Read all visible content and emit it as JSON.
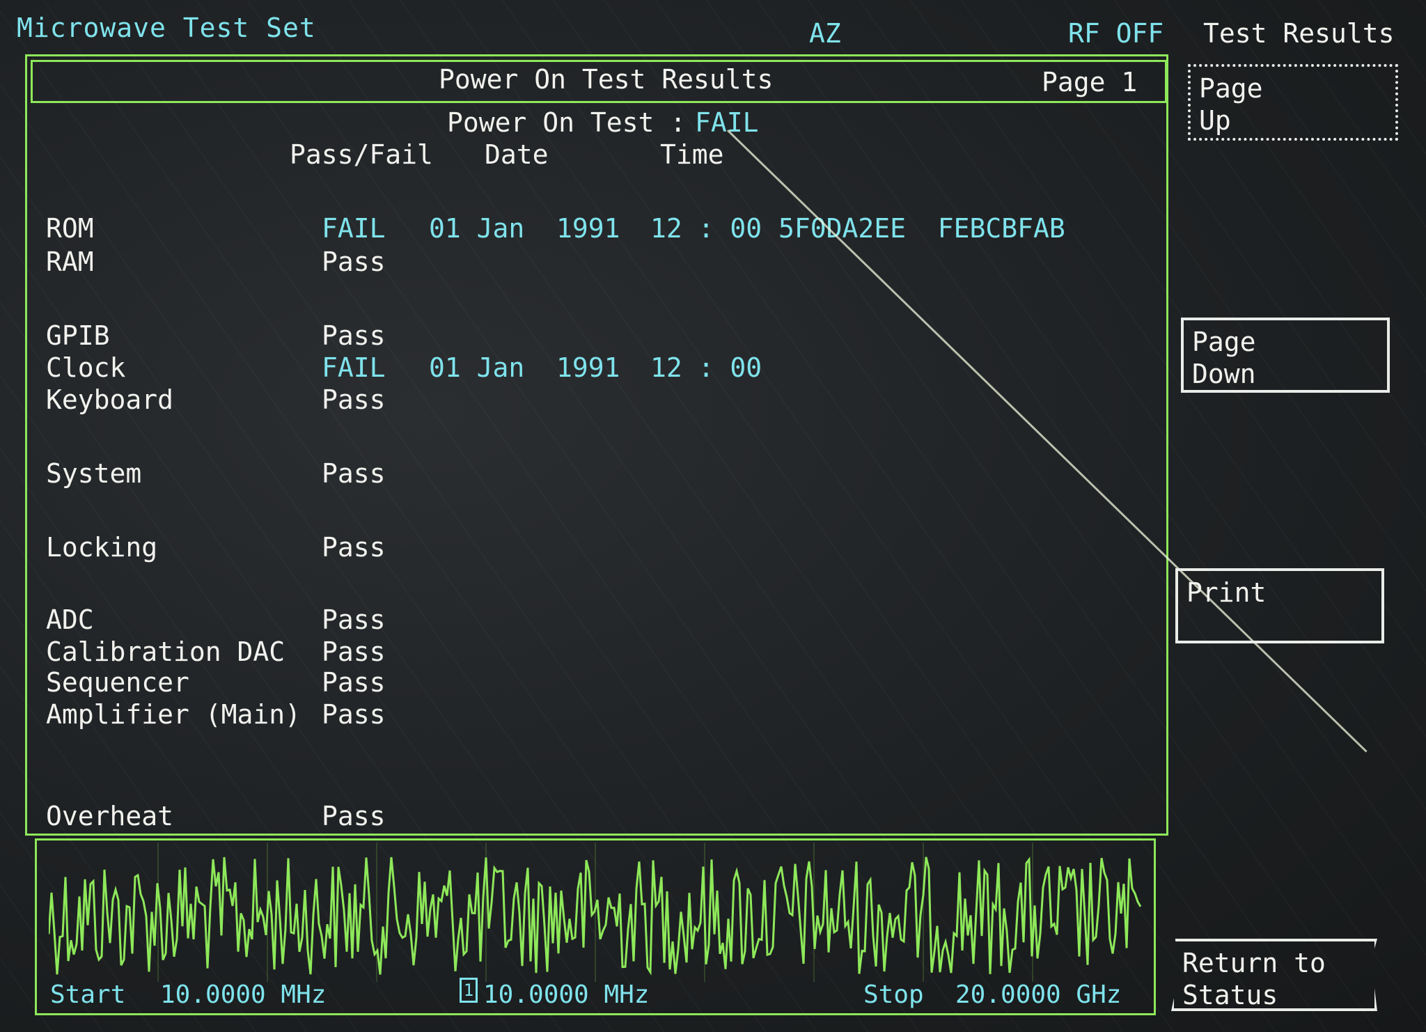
{
  "status_bar": {
    "instrument": "Microwave Test Set",
    "az": "AZ",
    "rf": "RF OFF",
    "menu_title": "Test Results"
  },
  "header": {
    "title": "Power On Test Results",
    "page": "Page 1"
  },
  "summary": {
    "label": "Power On Test :",
    "value": "FAIL"
  },
  "columns": {
    "pass_fail": "Pass/Fail",
    "date": "Date",
    "time": "Time"
  },
  "rows": [
    {
      "name": "ROM",
      "status": "FAIL",
      "date": "01 Jan  1991",
      "time": "12 : 00",
      "code": "5F0DA2EE  FEBCBFAB"
    },
    {
      "name": "RAM",
      "status": "Pass"
    },
    {
      "name": "GPIB",
      "status": "Pass"
    },
    {
      "name": "Clock",
      "status": "FAIL",
      "date": "01 Jan  1991",
      "time": "12 : 00"
    },
    {
      "name": "Keyboard",
      "status": "Pass"
    },
    {
      "name": "System",
      "status": "Pass"
    },
    {
      "name": "Locking",
      "status": "Pass"
    },
    {
      "name": "ADC",
      "status": "Pass"
    },
    {
      "name": "Calibration DAC",
      "status": "Pass"
    },
    {
      "name": "Sequencer",
      "status": "Pass"
    },
    {
      "name": "Amplifier (Main)",
      "status": "Pass"
    },
    {
      "name": "Overheat",
      "status": "Pass"
    }
  ],
  "softkeys": {
    "page_up": "Page\nUp",
    "page_down": "Page\nDown",
    "print": "Print",
    "return": "Return to\nStatus"
  },
  "footer": {
    "start_label": "Start",
    "start_value": "10.0000 MHz",
    "marker_value": "10.0000 MHz",
    "marker_icon": "marker-box-icon",
    "stop_label": "Stop",
    "stop_value": "20.0000 GHz"
  },
  "colors": {
    "trace": "#8ee85a",
    "highlight": "#7fe3ec",
    "text": "#f2f2ee"
  }
}
